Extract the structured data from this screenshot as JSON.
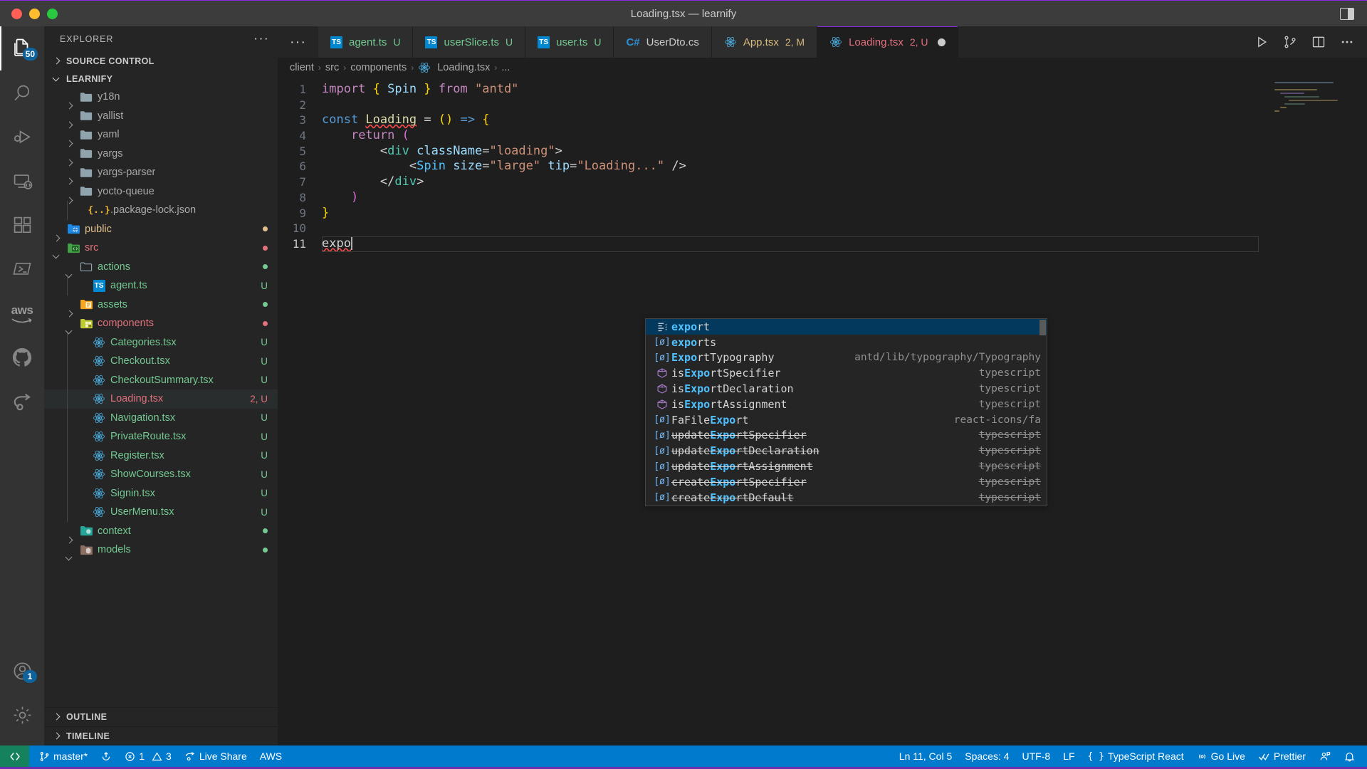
{
  "window": {
    "title": "Loading.tsx — learnify",
    "traffic_lights": [
      "close",
      "minimize",
      "zoom"
    ],
    "layout_toggle_icon": "layout-panel-icon"
  },
  "activity_bar": {
    "items": [
      {
        "name": "explorer",
        "icon": "files-icon",
        "badge": "50",
        "active": true
      },
      {
        "name": "search",
        "icon": "search-icon",
        "badge": ""
      },
      {
        "name": "run-and-debug",
        "icon": "run-debug-icon",
        "badge": ""
      },
      {
        "name": "remote-explorer",
        "icon": "remote-icon",
        "badge": ""
      },
      {
        "name": "extensions",
        "icon": "extensions-icon",
        "badge": ""
      },
      {
        "name": "terminal-powershell",
        "icon": "powershell-icon",
        "badge": ""
      },
      {
        "name": "aws-toolkit",
        "icon": "aws-icon",
        "badge": ""
      },
      {
        "name": "github",
        "icon": "github-icon",
        "badge": ""
      },
      {
        "name": "live-share",
        "icon": "live-share-icon",
        "badge": ""
      }
    ],
    "bottom_items": [
      {
        "name": "accounts",
        "icon": "account-icon",
        "badge": "1"
      },
      {
        "name": "settings",
        "icon": "gear-icon",
        "badge": ""
      }
    ]
  },
  "sidebar": {
    "header_title": "EXPLORER",
    "more_actions": "···",
    "sections": [
      {
        "label": "SOURCE CONTROL",
        "expanded": false
      },
      {
        "label": "LEARNIFY",
        "expanded": true
      },
      {
        "label": "OUTLINE",
        "expanded": false
      },
      {
        "label": "TIMELINE",
        "expanded": false
      }
    ],
    "tree": [
      {
        "label": "y18n",
        "icon": "folder-icon",
        "type": "folder",
        "depth": 2,
        "expanded": false,
        "color": "grey",
        "status": "",
        "dot": ""
      },
      {
        "label": "yallist",
        "icon": "folder-icon",
        "type": "folder",
        "depth": 2,
        "expanded": false,
        "color": "grey",
        "status": "",
        "dot": ""
      },
      {
        "label": "yaml",
        "icon": "folder-icon",
        "type": "folder",
        "depth": 2,
        "expanded": false,
        "color": "grey",
        "status": "",
        "dot": ""
      },
      {
        "label": "yargs",
        "icon": "folder-icon",
        "type": "folder",
        "depth": 2,
        "expanded": false,
        "color": "grey",
        "status": "",
        "dot": ""
      },
      {
        "label": "yargs-parser",
        "icon": "folder-icon",
        "type": "folder",
        "depth": 2,
        "expanded": false,
        "color": "grey",
        "status": "",
        "dot": ""
      },
      {
        "label": "yocto-queue",
        "icon": "folder-icon",
        "type": "folder",
        "depth": 2,
        "expanded": false,
        "color": "grey",
        "status": "",
        "dot": ""
      },
      {
        "label": ".package-lock.json",
        "icon": "json-icon",
        "type": "file",
        "depth": 3,
        "expanded": null,
        "color": "grey",
        "status": "",
        "dot": ""
      },
      {
        "label": "public",
        "icon": "folder-public-icon",
        "type": "folder",
        "depth": 1,
        "expanded": false,
        "color": "orange",
        "status": "",
        "dot": "#e2c08d"
      },
      {
        "label": "src",
        "icon": "folder-src-icon",
        "type": "folder",
        "depth": 1,
        "expanded": true,
        "color": "red",
        "status": "",
        "dot": "#e2707d"
      },
      {
        "label": "actions",
        "icon": "folder-open-icon",
        "type": "folder",
        "depth": 2,
        "expanded": true,
        "color": "green",
        "status": "",
        "dot": "#73c991"
      },
      {
        "label": "agent.ts",
        "icon": "ts-icon",
        "type": "file",
        "depth": 3,
        "expanded": null,
        "color": "green",
        "status": "U",
        "dot": ""
      },
      {
        "label": "assets",
        "icon": "folder-assets-icon",
        "type": "folder",
        "depth": 2,
        "expanded": false,
        "color": "green",
        "status": "",
        "dot": "#73c991"
      },
      {
        "label": "components",
        "icon": "folder-components-icon",
        "type": "folder",
        "depth": 2,
        "expanded": true,
        "color": "red",
        "status": "",
        "dot": "#e2707d"
      },
      {
        "label": "Categories.tsx",
        "icon": "react-icon",
        "type": "file",
        "depth": 3,
        "expanded": null,
        "color": "green",
        "status": "U",
        "dot": ""
      },
      {
        "label": "Checkout.tsx",
        "icon": "react-icon",
        "type": "file",
        "depth": 3,
        "expanded": null,
        "color": "green",
        "status": "U",
        "dot": ""
      },
      {
        "label": "CheckoutSummary.tsx",
        "icon": "react-icon",
        "type": "file",
        "depth": 3,
        "expanded": null,
        "color": "green",
        "status": "U",
        "dot": ""
      },
      {
        "label": "Loading.tsx",
        "icon": "react-icon",
        "type": "file",
        "depth": 3,
        "expanded": null,
        "color": "red",
        "status": "2, U",
        "dot": "",
        "selected": true
      },
      {
        "label": "Navigation.tsx",
        "icon": "react-icon",
        "type": "file",
        "depth": 3,
        "expanded": null,
        "color": "green",
        "status": "U",
        "dot": ""
      },
      {
        "label": "PrivateRoute.tsx",
        "icon": "react-icon",
        "type": "file",
        "depth": 3,
        "expanded": null,
        "color": "green",
        "status": "U",
        "dot": ""
      },
      {
        "label": "Register.tsx",
        "icon": "react-icon",
        "type": "file",
        "depth": 3,
        "expanded": null,
        "color": "green",
        "status": "U",
        "dot": ""
      },
      {
        "label": "ShowCourses.tsx",
        "icon": "react-icon",
        "type": "file",
        "depth": 3,
        "expanded": null,
        "color": "green",
        "status": "U",
        "dot": ""
      },
      {
        "label": "Signin.tsx",
        "icon": "react-icon",
        "type": "file",
        "depth": 3,
        "expanded": null,
        "color": "green",
        "status": "U",
        "dot": ""
      },
      {
        "label": "UserMenu.tsx",
        "icon": "react-icon",
        "type": "file",
        "depth": 3,
        "expanded": null,
        "color": "green",
        "status": "U",
        "dot": ""
      },
      {
        "label": "context",
        "icon": "folder-context-icon",
        "type": "folder",
        "depth": 2,
        "expanded": false,
        "color": "green",
        "status": "",
        "dot": "#73c991"
      },
      {
        "label": "models",
        "icon": "folder-models-icon",
        "type": "folder",
        "depth": 2,
        "expanded": true,
        "color": "green",
        "status": "",
        "dot": "#73c991"
      }
    ]
  },
  "tabs": [
    {
      "label": "agent.ts",
      "icon": "ts-icon",
      "status": "U",
      "color": "green",
      "active": false,
      "dirty": false
    },
    {
      "label": "userSlice.ts",
      "icon": "ts-icon",
      "status": "U",
      "color": "green",
      "active": false,
      "dirty": false
    },
    {
      "label": "user.ts",
      "icon": "ts-icon",
      "status": "U",
      "color": "green",
      "active": false,
      "dirty": false
    },
    {
      "label": "UserDto.cs",
      "icon": "csharp-icon",
      "status": "",
      "color": "grey",
      "active": false,
      "dirty": false
    },
    {
      "label": "App.tsx",
      "icon": "react-icon",
      "status": "2, M",
      "color": "yellow",
      "active": false,
      "dirty": false
    },
    {
      "label": "Loading.tsx",
      "icon": "react-icon",
      "status": "2, U",
      "color": "red",
      "active": true,
      "dirty": true
    }
  ],
  "tab_actions": [
    {
      "name": "run-button",
      "icon": "play-icon"
    },
    {
      "name": "source-control-button",
      "icon": "branch-icon"
    },
    {
      "name": "split-editor-button",
      "icon": "split-icon"
    },
    {
      "name": "more-actions-button",
      "icon": "ellipsis-icon"
    }
  ],
  "breadcrumb": [
    "client",
    "src",
    "components",
    "Loading.tsx",
    "..."
  ],
  "editor": {
    "filename": "Loading.tsx",
    "lines": [
      {
        "n": "1",
        "tokens": [
          {
            "t": "import ",
            "c": "kw"
          },
          {
            "t": "{ ",
            "c": "br1"
          },
          {
            "t": "Spin",
            "c": "var"
          },
          {
            "t": " } ",
            "c": "br1"
          },
          {
            "t": "from ",
            "c": "kw"
          },
          {
            "t": "\"antd\"",
            "c": "str"
          }
        ]
      },
      {
        "n": "2",
        "tokens": []
      },
      {
        "n": "3",
        "tokens": [
          {
            "t": "const ",
            "c": "kw2"
          },
          {
            "t": "Loading",
            "c": "fn-sq"
          },
          {
            "t": " = ",
            "c": "pl"
          },
          {
            "t": "(",
            "c": "br1"
          },
          {
            "t": ")",
            "c": "br1"
          },
          {
            "t": " => ",
            "c": "kw2"
          },
          {
            "t": "{",
            "c": "br1"
          }
        ]
      },
      {
        "n": "4",
        "tokens": [
          {
            "t": "    ",
            "c": "pl"
          },
          {
            "t": "return ",
            "c": "kw"
          },
          {
            "t": "(",
            "c": "br2"
          }
        ]
      },
      {
        "n": "5",
        "tokens": [
          {
            "t": "        ",
            "c": "pl"
          },
          {
            "t": "<",
            "c": "pl"
          },
          {
            "t": "div",
            "c": "tag"
          },
          {
            "t": " className",
            "c": "att"
          },
          {
            "t": "=",
            "c": "pl"
          },
          {
            "t": "\"loading\"",
            "c": "str"
          },
          {
            "t": ">",
            "c": "pl"
          }
        ]
      },
      {
        "n": "6",
        "tokens": [
          {
            "t": "            ",
            "c": "pl"
          },
          {
            "t": "<",
            "c": "pl"
          },
          {
            "t": "Spin",
            "c": "cls"
          },
          {
            "t": " size",
            "c": "att"
          },
          {
            "t": "=",
            "c": "pl"
          },
          {
            "t": "\"large\"",
            "c": "str"
          },
          {
            "t": " tip",
            "c": "att"
          },
          {
            "t": "=",
            "c": "pl"
          },
          {
            "t": "\"Loading...\"",
            "c": "str"
          },
          {
            "t": " />",
            "c": "pl"
          }
        ]
      },
      {
        "n": "7",
        "tokens": [
          {
            "t": "        ",
            "c": "pl"
          },
          {
            "t": "</",
            "c": "pl"
          },
          {
            "t": "div",
            "c": "tag"
          },
          {
            "t": ">",
            "c": "pl"
          }
        ]
      },
      {
        "n": "8",
        "tokens": [
          {
            "t": "    ",
            "c": "pl"
          },
          {
            "t": ")",
            "c": "br2"
          }
        ]
      },
      {
        "n": "9",
        "tokens": [
          {
            "t": "}",
            "c": "br1"
          }
        ]
      },
      {
        "n": "10",
        "tokens": []
      },
      {
        "n": "11",
        "tokens": [
          {
            "t": "expo",
            "c": "sq"
          }
        ],
        "current": true
      }
    ]
  },
  "suggest": {
    "items": [
      {
        "icon": "keyword-icon",
        "prefix": "expo",
        "rest": "rt",
        "pre": "",
        "detail": "",
        "selected": true,
        "strike": false
      },
      {
        "icon": "variable-icon",
        "prefix": "expo",
        "rest": "rts",
        "pre": "",
        "detail": "",
        "selected": false,
        "strike": false
      },
      {
        "icon": "variable-icon",
        "prefix": "Expo",
        "rest": "rtTypography",
        "pre": "",
        "detail": "antd/lib/typography/Typography",
        "selected": false,
        "strike": false
      },
      {
        "icon": "function-icon",
        "prefix": "Expo",
        "rest": "rtSpecifier",
        "pre": "is",
        "detail": "typescript",
        "selected": false,
        "strike": false
      },
      {
        "icon": "function-icon",
        "prefix": "Expo",
        "rest": "rtDeclaration",
        "pre": "is",
        "detail": "typescript",
        "selected": false,
        "strike": false
      },
      {
        "icon": "function-icon",
        "prefix": "Expo",
        "rest": "rtAssignment",
        "pre": "is",
        "detail": "typescript",
        "selected": false,
        "strike": false
      },
      {
        "icon": "variable-icon",
        "prefix": "Expo",
        "rest": "rt",
        "pre": "FaFile",
        "detail": "react-icons/fa",
        "selected": false,
        "strike": false
      },
      {
        "icon": "variable-icon",
        "prefix": "Expo",
        "rest": "rtSpecifier",
        "pre": "update",
        "detail": "typescript",
        "selected": false,
        "strike": true
      },
      {
        "icon": "variable-icon",
        "prefix": "Expo",
        "rest": "rtDeclaration",
        "pre": "update",
        "detail": "typescript",
        "selected": false,
        "strike": true
      },
      {
        "icon": "variable-icon",
        "prefix": "Expo",
        "rest": "rtAssignment",
        "pre": "update",
        "detail": "typescript",
        "selected": false,
        "strike": true
      },
      {
        "icon": "variable-icon",
        "prefix": "Expo",
        "rest": "rtSpecifier",
        "pre": "create",
        "detail": "typescript",
        "selected": false,
        "strike": true
      },
      {
        "icon": "variable-icon",
        "prefix": "Expo",
        "rest": "rtDefault",
        "pre": "create",
        "detail": "typescript",
        "selected": false,
        "strike": true
      }
    ]
  },
  "status_bar": {
    "remote_icon": "remote-window-icon",
    "left": [
      {
        "name": "branch",
        "icon": "branch-icon",
        "label": "master*"
      },
      {
        "name": "sync",
        "icon": "sync-icon",
        "label": ""
      },
      {
        "name": "problems",
        "icon": "error-warning-icon",
        "label": "1",
        "label2": "3"
      },
      {
        "name": "live-share",
        "icon": "live-share-icon",
        "label": "Live Share"
      },
      {
        "name": "aws",
        "icon": "",
        "label": "AWS"
      }
    ],
    "right": [
      {
        "name": "cursor-position",
        "icon": "",
        "label": "Ln 11, Col 5"
      },
      {
        "name": "indentation",
        "icon": "",
        "label": "Spaces: 4"
      },
      {
        "name": "encoding",
        "icon": "",
        "label": "UTF-8"
      },
      {
        "name": "eol",
        "icon": "",
        "label": "LF"
      },
      {
        "name": "language-mode",
        "icon": "braces-icon",
        "label": "TypeScript React"
      },
      {
        "name": "go-live",
        "icon": "broadcast-icon",
        "label": "Go Live"
      },
      {
        "name": "prettier",
        "icon": "check-check-icon",
        "label": "Prettier"
      },
      {
        "name": "feedback",
        "icon": "feedback-icon",
        "label": ""
      },
      {
        "name": "notifications",
        "icon": "bell-icon",
        "label": ""
      }
    ]
  },
  "colors": {
    "accent": "#007acc",
    "remote": "#16825d",
    "purple_border": "#8a2be2",
    "selection": "#04395e",
    "green_status": "#73c991",
    "red_status": "#e2707d",
    "orange_status": "#e2c08d"
  }
}
